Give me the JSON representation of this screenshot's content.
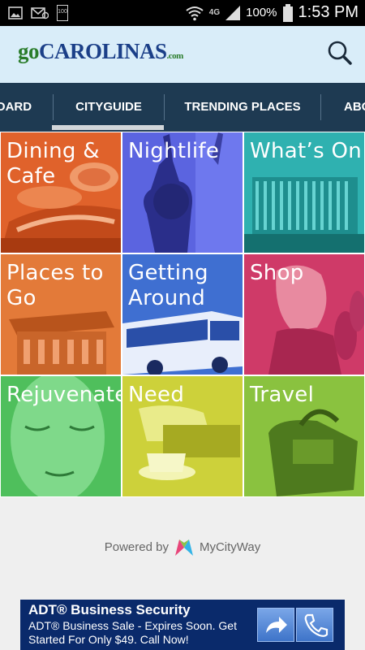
{
  "status_bar": {
    "network_label": "4G",
    "battery_percent": "100%",
    "time": "1:53 PM",
    "battery_badge": "100",
    "icons": [
      "image-icon",
      "email-icon",
      "battery-small-icon",
      "wifi-icon",
      "signal-icon",
      "battery-icon"
    ]
  },
  "header": {
    "logo_go": "go",
    "logo_name": "CAROLINAS",
    "logo_suffix": ".com",
    "search_icon": "search-icon"
  },
  "tabs": [
    {
      "label": "OARD",
      "active": false
    },
    {
      "label": "CITYGUIDE",
      "active": true
    },
    {
      "label": "TRENDING PLACES",
      "active": false
    },
    {
      "label": "ABO",
      "active": false
    }
  ],
  "tiles": [
    {
      "label": "Dining &\nCafe",
      "color": "#e0622b"
    },
    {
      "label": "Nightlife",
      "color": "#5b64e0"
    },
    {
      "label": "What’s On",
      "color": "#2fb1b0"
    },
    {
      "label": "Places to\nGo",
      "color": "#e37a39"
    },
    {
      "label": "Getting\nAround",
      "color": "#3f6fd1"
    },
    {
      "label": "Shop",
      "color": "#cf3a68"
    },
    {
      "label": "Rejuvenate",
      "color": "#4fbf5c"
    },
    {
      "label": "Need",
      "color": "#cdd13a"
    },
    {
      "label": "Travel",
      "color": "#8ac23f"
    }
  ],
  "powered_by": {
    "prefix": "Powered by",
    "brand": "MyCityWay"
  },
  "ad": {
    "title": "ADT® Business Security",
    "body": "ADT® Business Sale - Expires Soon. Get Started For Only $49. Call Now!",
    "icons": [
      "arrow-icon",
      "phone-icon"
    ]
  }
}
